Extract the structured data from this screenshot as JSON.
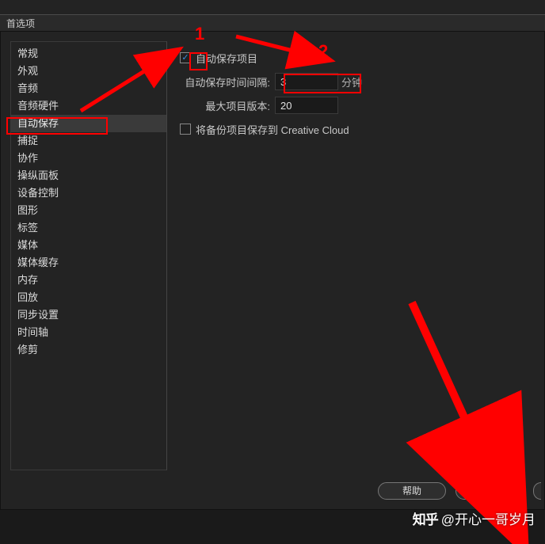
{
  "titlebar": {
    "title": "首选项"
  },
  "sidebar": {
    "items": [
      {
        "label": "常规"
      },
      {
        "label": "外观"
      },
      {
        "label": "音频"
      },
      {
        "label": "音频硬件"
      },
      {
        "label": "自动保存",
        "selected": true
      },
      {
        "label": "捕捉"
      },
      {
        "label": "协作"
      },
      {
        "label": "操纵面板"
      },
      {
        "label": "设备控制"
      },
      {
        "label": "图形"
      },
      {
        "label": "标签"
      },
      {
        "label": "媒体"
      },
      {
        "label": "媒体缓存"
      },
      {
        "label": "内存"
      },
      {
        "label": "回放"
      },
      {
        "label": "同步设置"
      },
      {
        "label": "时间轴"
      },
      {
        "label": "修剪"
      }
    ]
  },
  "content": {
    "autoSaveProject": {
      "label": "自动保存项目",
      "checked": true
    },
    "interval": {
      "label": "自动保存时间间隔:",
      "value": "3",
      "unit": "分钟"
    },
    "maxVersions": {
      "label": "最大项目版本:",
      "value": "20"
    },
    "saveBackupToCC": {
      "label": "将备份项目保存到 Creative Cloud",
      "checked": false
    }
  },
  "footer": {
    "help": "帮助",
    "ok": "确定"
  },
  "annotations": {
    "label1": "1",
    "label2": "2"
  },
  "watermark": {
    "brand": "知乎",
    "author": "@开心一哥岁月"
  }
}
